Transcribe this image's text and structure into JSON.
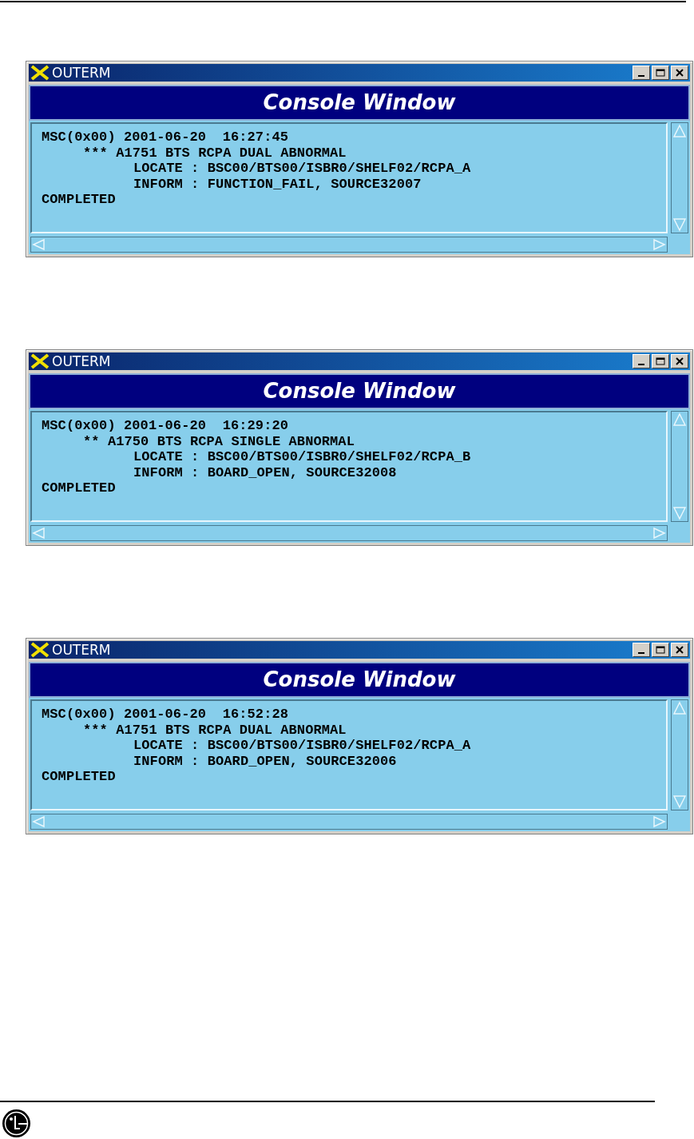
{
  "windows": [
    {
      "title": "OUTERM",
      "banner": "Console Window",
      "lines": [
        {
          "kind": "header",
          "text": "MSC(0x00) 2001-06-20  16:27:45"
        },
        {
          "kind": "alarm",
          "mark": "***",
          "text": "A1751 BTS RCPA DUAL ABNORMAL"
        },
        {
          "kind": "detail",
          "text": "LOCATE : BSC00/BTS00/ISBR0/SHELF02/RCPA_A"
        },
        {
          "kind": "detail",
          "text": "INFORM : FUNCTION_FAIL, SOURCE32007"
        },
        {
          "kind": "end",
          "text": "COMPLETED"
        }
      ]
    },
    {
      "title": "OUTERM",
      "banner": "Console Window",
      "lines": [
        {
          "kind": "header",
          "text": "MSC(0x00) 2001-06-20  16:29:20"
        },
        {
          "kind": "alarm",
          "mark": "**",
          "text": "A1750 BTS RCPA SINGLE ABNORMAL"
        },
        {
          "kind": "detail",
          "text": "LOCATE : BSC00/BTS00/ISBR0/SHELF02/RCPA_B"
        },
        {
          "kind": "detail",
          "text": "INFORM : BOARD_OPEN, SOURCE32008"
        },
        {
          "kind": "end",
          "text": "COMPLETED"
        }
      ]
    },
    {
      "title": "OUTERM",
      "banner": "Console Window",
      "lines": [
        {
          "kind": "header",
          "text": "MSC(0x00) 2001-06-20  16:52:28"
        },
        {
          "kind": "alarm",
          "mark": "***",
          "text": "A1751 BTS RCPA DUAL ABNORMAL"
        },
        {
          "kind": "detail",
          "text": "LOCATE : BSC00/BTS00/ISBR0/SHELF02/RCPA_A"
        },
        {
          "kind": "detail",
          "text": "INFORM : BOARD_OPEN, SOURCE32006"
        },
        {
          "kind": "end",
          "text": "COMPLETED"
        }
      ]
    }
  ]
}
